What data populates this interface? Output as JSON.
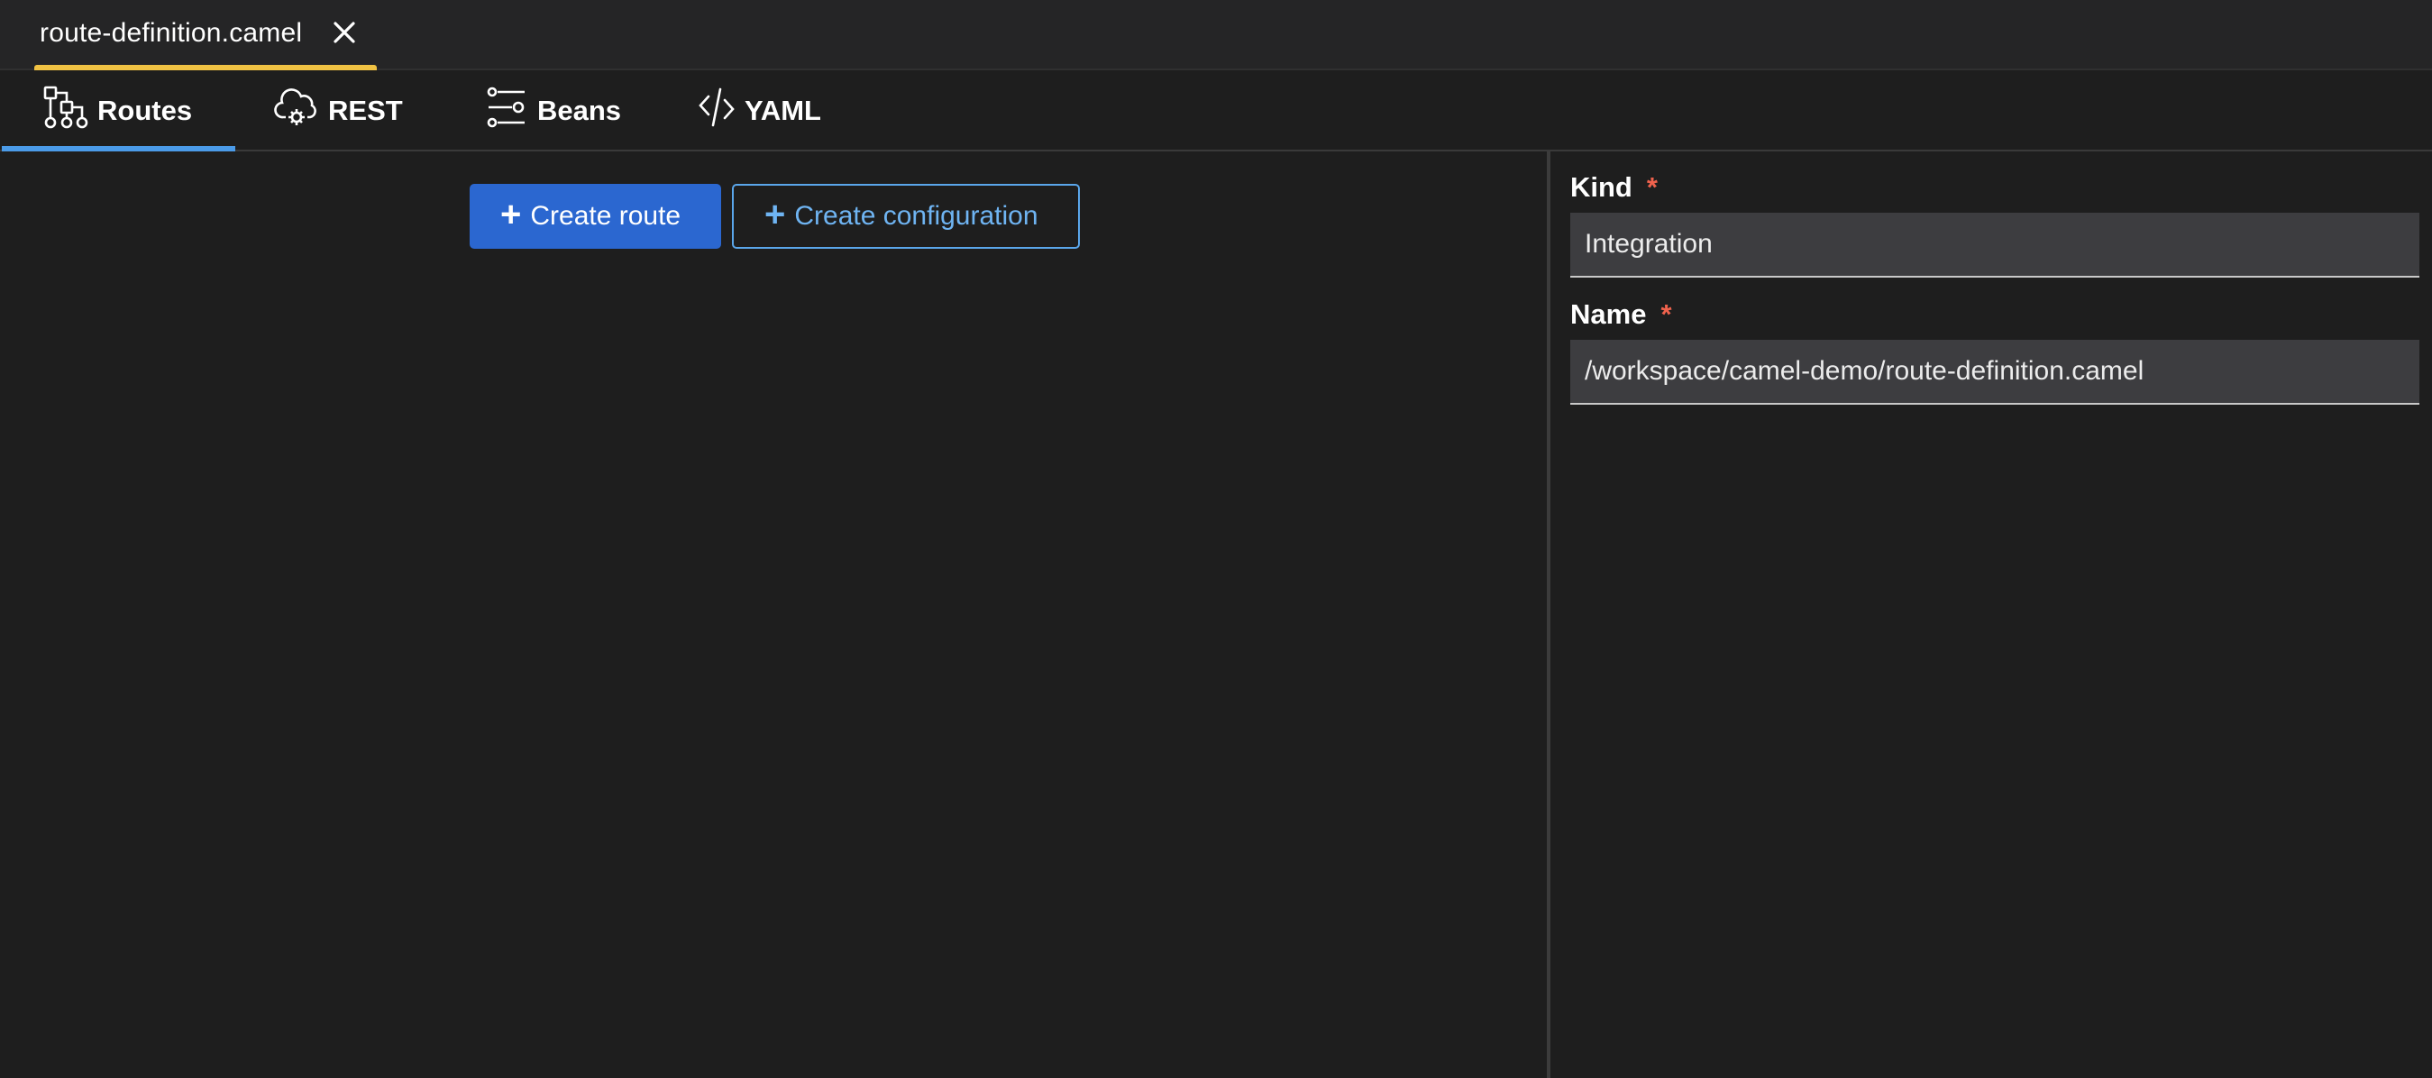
{
  "editor": {
    "file_tab": {
      "label": "route-definition.camel",
      "close_icon": "close-icon"
    }
  },
  "view_tabs": [
    {
      "label": "Routes",
      "icon": "routes-flow-icon",
      "active": true
    },
    {
      "label": "REST",
      "icon": "cloud-gear-icon",
      "active": false
    },
    {
      "label": "Beans",
      "icon": "sliders-icon",
      "active": false
    },
    {
      "label": "YAML",
      "icon": "code-icon",
      "active": false
    }
  ],
  "canvas": {
    "create_route_label": "Create route",
    "create_configuration_label": "Create configuration"
  },
  "properties": {
    "kind": {
      "label": "Kind",
      "required_mark": "*",
      "value": "Integration"
    },
    "name": {
      "label": "Name",
      "required_mark": "*",
      "value": "/workspace/camel-demo/route-definition.camel"
    }
  },
  "colors": {
    "background": "#1e1e1e",
    "tab_strip": "#252526",
    "active_file_underline": "#f0c243",
    "active_view_underline": "#4b9be8",
    "primary_button": "#2b67d0",
    "secondary_button_text": "#6fb4f2",
    "required_mark": "#f0624d",
    "input_background": "#3d3d40"
  }
}
